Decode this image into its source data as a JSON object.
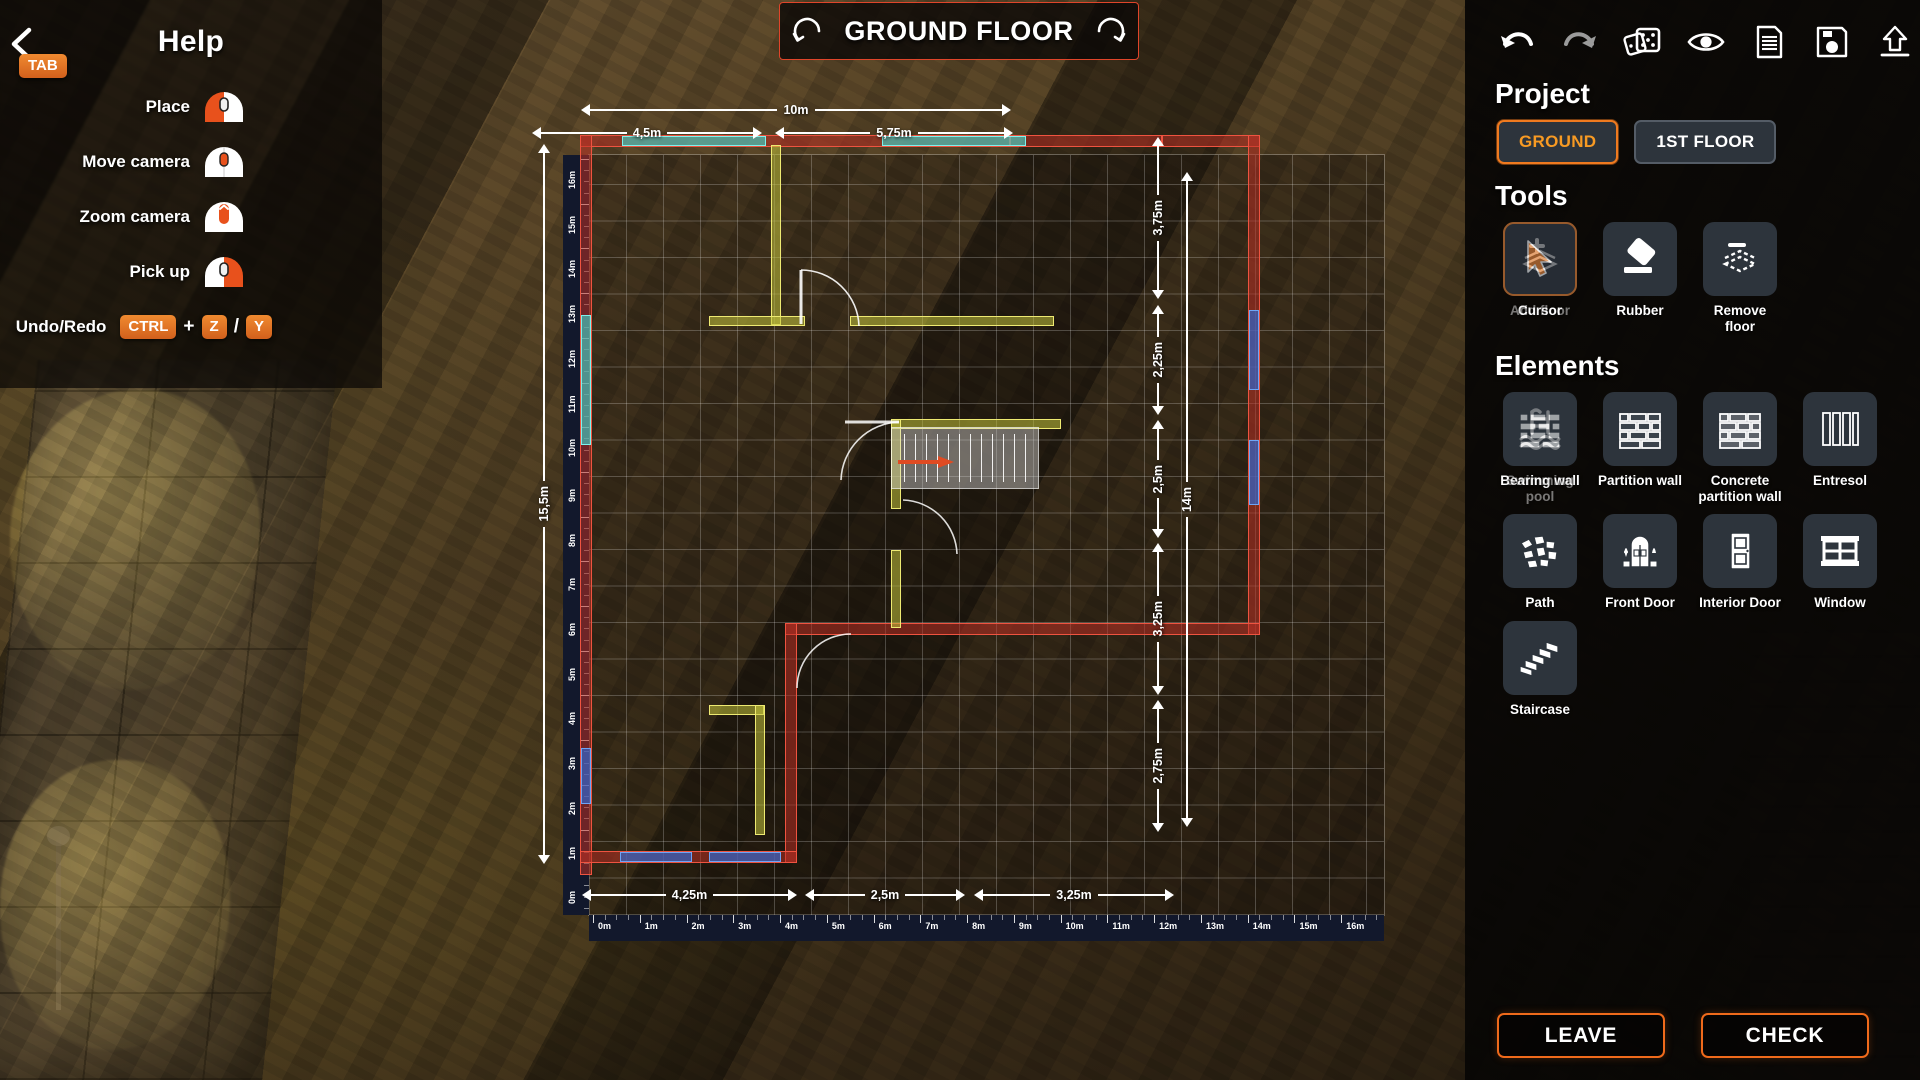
{
  "help": {
    "title": "Help",
    "tab_key": "TAB",
    "back_icon": "chevron-left-icon",
    "rows": [
      {
        "label": "Place",
        "icon": "mouse-left-click-icon"
      },
      {
        "label": "Move camera",
        "icon": "mouse-middle-drag-icon"
      },
      {
        "label": "Zoom camera",
        "icon": "mouse-scroll-icon"
      },
      {
        "label": "Pick up",
        "icon": "mouse-right-click-icon"
      }
    ],
    "undo_redo": {
      "label": "Undo/Redo",
      "keys": [
        "CTRL",
        "Z",
        "Y"
      ],
      "plus": "+",
      "slash": "/"
    }
  },
  "floor_title": {
    "text": "GROUND FLOOR",
    "rotate_left": "rotate-left-icon",
    "rotate_right": "rotate-right-icon"
  },
  "toolbar": {
    "items": [
      {
        "name": "undo-icon",
        "label": "Undo",
        "enabled": true
      },
      {
        "name": "redo-icon",
        "label": "Redo",
        "enabled": false
      },
      {
        "name": "dice-icon",
        "label": "Randomize",
        "enabled": true
      },
      {
        "name": "eye-icon",
        "label": "Preview",
        "enabled": true
      },
      {
        "name": "document-icon",
        "label": "Notes",
        "enabled": true
      },
      {
        "name": "save-icon",
        "label": "Save",
        "enabled": true
      },
      {
        "name": "export-icon",
        "label": "Export",
        "enabled": true
      }
    ]
  },
  "project": {
    "heading": "Project",
    "floors": [
      {
        "label": "GROUND",
        "selected": true
      },
      {
        "label": "1ST FLOOR",
        "selected": false
      }
    ]
  },
  "tools": {
    "heading": "Tools",
    "items": [
      {
        "label": "Cursor",
        "icon": "cursor-icon",
        "selected": true,
        "enabled": true
      },
      {
        "label": "Rubber",
        "icon": "eraser-icon",
        "selected": false,
        "enabled": true
      },
      {
        "label": "Add floor",
        "icon": "add-floor-icon",
        "selected": false,
        "enabled": false
      },
      {
        "label": "Remove floor",
        "icon": "remove-floor-icon",
        "selected": false,
        "enabled": true
      }
    ]
  },
  "elements": {
    "heading": "Elements",
    "items": [
      {
        "label": "Bearing wall",
        "icon": "bearing-wall-icon",
        "enabled": true
      },
      {
        "label": "Partition wall",
        "icon": "partition-wall-icon",
        "enabled": true
      },
      {
        "label": "Concrete\npartition wall",
        "icon": "concrete-wall-icon",
        "enabled": true
      },
      {
        "label": "Entresol",
        "icon": "entresol-icon",
        "enabled": true
      },
      {
        "label": "Path",
        "icon": "path-icon",
        "enabled": true
      },
      {
        "label": "Front Door",
        "icon": "front-door-icon",
        "enabled": true
      },
      {
        "label": "Interior Door",
        "icon": "interior-door-icon",
        "enabled": true
      },
      {
        "label": "Window",
        "icon": "window-icon",
        "enabled": true
      },
      {
        "label": "Staircase",
        "icon": "staircase-icon",
        "enabled": true
      },
      {
        "label": "Swimming pool",
        "icon": "swimming-pool-icon",
        "enabled": false
      }
    ]
  },
  "actions": {
    "leave": "LEAVE",
    "check": "CHECK"
  },
  "plan": {
    "colors": {
      "bearing_wall": "#ef5340",
      "partition_wall": "#eeea72",
      "window_cyan": "#7df2ec",
      "window_blue": "#6ea4f6",
      "stair_arrow": "#e04b22",
      "accent": "#ef7a1f"
    },
    "dimensions": {
      "top_total": "10m",
      "top_segments": [
        "4,5m",
        "5,75m"
      ],
      "bottom_segments": [
        "4,25m",
        "2,5m",
        "3,25m"
      ],
      "left_total": "15,5m",
      "right_total": "14m",
      "right_segments": [
        "3,75m",
        "2,25m",
        "2,5m",
        "3,25m",
        "2,75m"
      ]
    },
    "rulers": {
      "bottom": [
        "0m",
        "1m",
        "2m",
        "3m",
        "4m",
        "5m",
        "6m",
        "7m",
        "8m",
        "9m",
        "10m",
        "11m",
        "12m",
        "13m",
        "14m",
        "15m",
        "16m"
      ],
      "left": [
        "16m",
        "15m",
        "14m",
        "13m",
        "12m",
        "11m",
        "10m",
        "9m",
        "8m",
        "7m",
        "6m",
        "5m",
        "4m",
        "3m",
        "2m",
        "1m",
        "0m"
      ]
    }
  }
}
